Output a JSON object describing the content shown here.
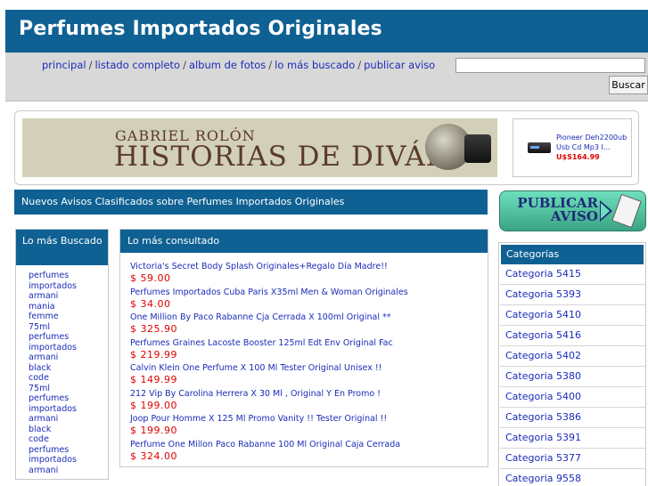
{
  "site": {
    "title": "Perfumes Importados Originales"
  },
  "nav": {
    "links": [
      "principal",
      "listado completo",
      "album de fotos",
      "lo más buscado",
      "publicar aviso"
    ],
    "separator": "/"
  },
  "search": {
    "value": "",
    "button_label": "Buscar"
  },
  "banner": {
    "small_title": "GABRIEL ROLÓN",
    "big_title": "HISTORIAS DE DIVÁN"
  },
  "product": {
    "name": "Pioneer Deh2200ub Usb Cd Mp3 I...",
    "price": "U$S164.99"
  },
  "section_title": "Nuevos Avisos Clasificados sobre Perfumes Importados Originales",
  "publicar": {
    "line1": "PUBLICAR",
    "line2": "AVISO"
  },
  "most_searched": {
    "title": "Lo más Buscado",
    "tags": [
      "perfumes",
      "importados",
      "armani",
      "mania",
      "femme",
      "75ml",
      "perfumes",
      "importados",
      "armani",
      "black",
      "code",
      "75ml",
      "perfumes",
      "importados",
      "armani",
      "black",
      "code",
      "perfumes",
      "importados",
      "armani"
    ]
  },
  "most_viewed": {
    "title": "Lo más consultado",
    "items": [
      {
        "title": "Victoria's Secret Body Splash Originales+Regalo Día Madre!!",
        "price": "$ 59.00"
      },
      {
        "title": "Perfumes Importados Cuba Paris X35ml Men & Woman Originales",
        "price": "$ 34.00"
      },
      {
        "title": "One Million By Paco Rabanne Cja Cerrada X 100ml Original **",
        "price": "$ 325.90"
      },
      {
        "title": "Perfumes Graines Lacoste Booster 125ml Edt Env Original Fac",
        "price": "$ 219.99"
      },
      {
        "title": "Calvin Klein One Perfume X 100 Ml Tester Original Unisex !!",
        "price": "$ 149.99"
      },
      {
        "title": "212 Vip By Carolina Herrera X 30 Ml , Original Y En Promo !",
        "price": "$ 199.00"
      },
      {
        "title": "Joop Pour Homme X 125 Ml Promo Vanity !! Tester Original !!",
        "price": "$ 199.90"
      },
      {
        "title": "Perfume One Millon Paco Rabanne 100 Ml Original Caja Cerrada",
        "price": "$ 324.00"
      }
    ]
  },
  "categories": {
    "title": "Categorías",
    "items": [
      "Categoria 5415",
      "Categoria 5393",
      "Categoria 5410",
      "Categoria 5416",
      "Categoria 5402",
      "Categoria 5380",
      "Categoria 5400",
      "Categoria 5386",
      "Categoria 5391",
      "Categoria 5377",
      "Categoria 9558"
    ]
  },
  "colors": {
    "header_blue": "#0f6193",
    "link_blue": "#1a2cb8",
    "price_red": "#e00000",
    "navbar_gray": "#d8d8d8"
  }
}
